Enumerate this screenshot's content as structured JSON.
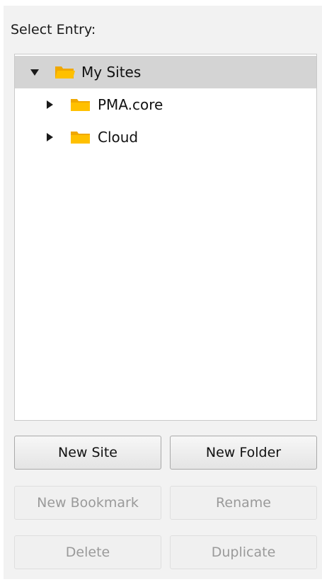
{
  "label": "Select Entry:",
  "tree": {
    "items": [
      {
        "label": "My Sites",
        "expanded": true,
        "selected": true,
        "icon": "folder-open-icon"
      },
      {
        "label": "PMA.core",
        "expanded": false,
        "selected": false,
        "icon": "folder-icon"
      },
      {
        "label": "Cloud",
        "expanded": false,
        "selected": false,
        "icon": "folder-icon"
      }
    ]
  },
  "buttons": {
    "new_site": {
      "label": "New Site",
      "enabled": true
    },
    "new_folder": {
      "label": "New Folder",
      "enabled": true
    },
    "new_bookmark": {
      "label": "New Bookmark",
      "enabled": false
    },
    "rename": {
      "label": "Rename",
      "enabled": false
    },
    "delete": {
      "label": "Delete",
      "enabled": false
    },
    "duplicate": {
      "label": "Duplicate",
      "enabled": false
    }
  },
  "colors": {
    "folder": "#ffc000",
    "folder_back": "#f0a800",
    "selection": "#d4d4d4",
    "panel": "#f2f2f2"
  }
}
